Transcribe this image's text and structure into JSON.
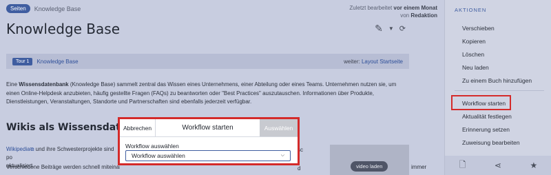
{
  "breadcrumb": {
    "badge": "Seiten",
    "text": "Knowledge Base"
  },
  "edit_info": {
    "line1_prefix": "Zuletzt bearbeitet ",
    "line1_bold": "vor einem Monat",
    "line2_prefix": "von ",
    "line2_bold": "Redaktion"
  },
  "page": {
    "title": "Knowledge Base"
  },
  "tour": {
    "badge": "Tour 1",
    "link": "Knowledge Base",
    "next_prefix": "weiter: ",
    "next_link": "Layout Startseite"
  },
  "intro": {
    "text_before": "Eine ",
    "bold": "Wissensdatenbank",
    "text_after": " (Knowledge Base) sammelt zentral das Wissen eines Unternehmens, einer Abteilung oder eines Teams. Unternehmen nutzen sie, um einen Online-Helpdesk anzubieten, häufig gestellte Fragen (FAQs) zu beantworten oder \"Best Practices\" auszutauschen. Informationen über Produkte, Dienstleistungen, Veranstaltungen, Standorte und Partnerschaften sind ebenfalls jederzeit verfügbar."
  },
  "section": {
    "heading": "Wikis als Wissensdatenbank",
    "p1_link": "Wikipedia",
    "p1_text": " und ihre Schwesterprojekte sind po",
    "p1_text2": "aktualisiert.",
    "p2_text": "Verschiedene Beiträge werden schnell miteinan",
    "side_text1": "sc",
    "side_text2": "d",
    "video_label": "video laden",
    "tail": "immer"
  },
  "sidebar": {
    "heading": "AKTIONEN",
    "items": [
      "Verschieben",
      "Kopieren",
      "Löschen",
      "Neu laden",
      "Zu einem Buch hinzufügen"
    ],
    "items2": [
      "Workflow starten",
      "Aktualität festlegen",
      "Erinnerung setzen",
      "Zuweisung bearbeiten"
    ]
  },
  "modal": {
    "cancel": "Abbrechen",
    "title": "Workflow starten",
    "select_button": "Auswählen",
    "field_label": "Workflow auswählen",
    "dropdown_value": "Workflow auswählen"
  }
}
